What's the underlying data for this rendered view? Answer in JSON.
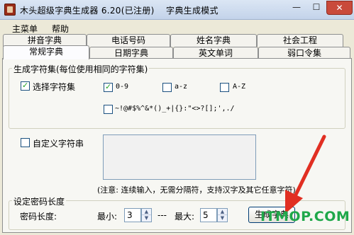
{
  "window": {
    "title": "木头超级字典生成器 6.20(已注册)    字典生成模式",
    "minimize": "—",
    "maximize": "☐",
    "close": "✕"
  },
  "menu": [
    "主菜单",
    "帮助"
  ],
  "tabs": {
    "row_top": [
      "拼音字典",
      "电话号码",
      "姓名字典",
      "社会工程"
    ],
    "row_bottom": [
      "常规字典",
      "日期字典",
      "英文单词",
      "弱口令集"
    ],
    "active": "常规字典"
  },
  "charset_group": {
    "title": "生成字符集(每位使用相同的字符集)",
    "select_label": "选择字符集",
    "select_checked": true,
    "options": [
      {
        "label": "0-9",
        "checked": true
      },
      {
        "label": "a-z",
        "checked": false
      },
      {
        "label": "A-Z",
        "checked": false
      },
      {
        "label": "~!@#$%^&*()_+|{}:\"<>?[];',./",
        "checked": false
      }
    ]
  },
  "custom_group": {
    "label": "自定义字符串",
    "checked": false,
    "textarea_value": "",
    "note": "(注意: 连续输入，无需分隔符，支持汉字及其它任意字符)"
  },
  "length_group": {
    "title": "设定密码长度",
    "label": "密码长度:",
    "min_label": "最小:",
    "min_value": "3",
    "dashes": "---",
    "max_label": "最大:",
    "max_value": "5",
    "spin_up": "▲",
    "spin_down": "▼"
  },
  "generate_button": "生成字典",
  "watermark": "ITMOP.COM",
  "colors": {
    "arrow": "#e12f22",
    "watermark": "#1fa84a",
    "check_mark": "#21a121"
  }
}
